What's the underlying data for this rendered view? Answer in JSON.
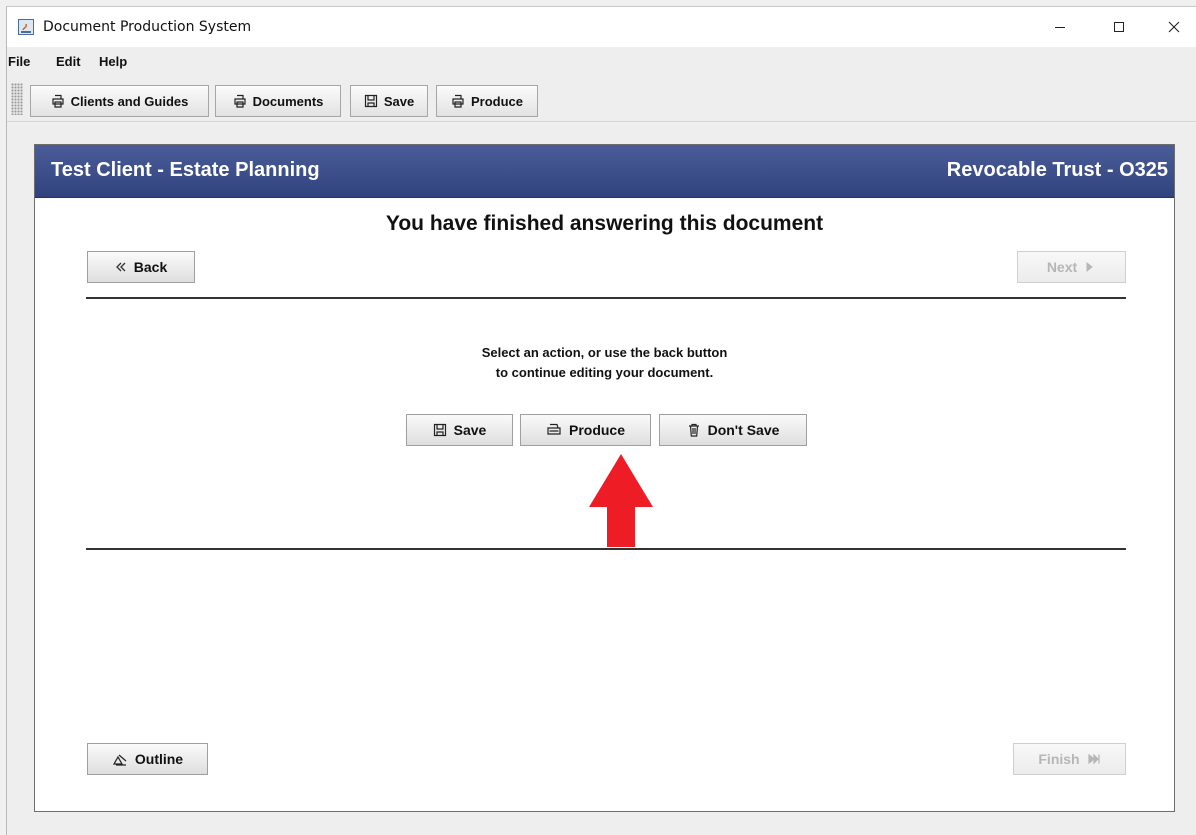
{
  "window": {
    "title": "Document Production System",
    "icon": "java-app-icon",
    "controls": [
      "minimize-icon",
      "maximize-icon",
      "close-icon"
    ]
  },
  "menubar": {
    "items": [
      "File",
      "Edit",
      "Help"
    ]
  },
  "toolbar": {
    "buttons": [
      {
        "label": "Clients and Guides",
        "icon": "printer-icon"
      },
      {
        "label": "Documents",
        "icon": "printer-icon"
      },
      {
        "label": "Save",
        "icon": "save-icon"
      },
      {
        "label": "Produce",
        "icon": "printer-icon"
      }
    ]
  },
  "panel": {
    "header_left": "Test Client - Estate Planning",
    "header_right": "Revocable Trust - O325",
    "heading": "You have finished answering this document",
    "nav": {
      "back_label": "Back",
      "next_label": "Next",
      "next_enabled": false
    },
    "instructions": [
      "Select an action, or use the back button",
      "to continue editing your document."
    ],
    "actions": {
      "save_label": "Save",
      "produce_label": "Produce",
      "dont_save_label": "Don't Save"
    },
    "footer": {
      "outline_label": "Outline",
      "finish_label": "Finish",
      "finish_enabled": false
    }
  },
  "colors": {
    "header_bg": "#3a4c88",
    "arrow": "#ee1c24"
  },
  "annotation": {
    "type": "arrow-up",
    "points_to": "produce-button"
  }
}
